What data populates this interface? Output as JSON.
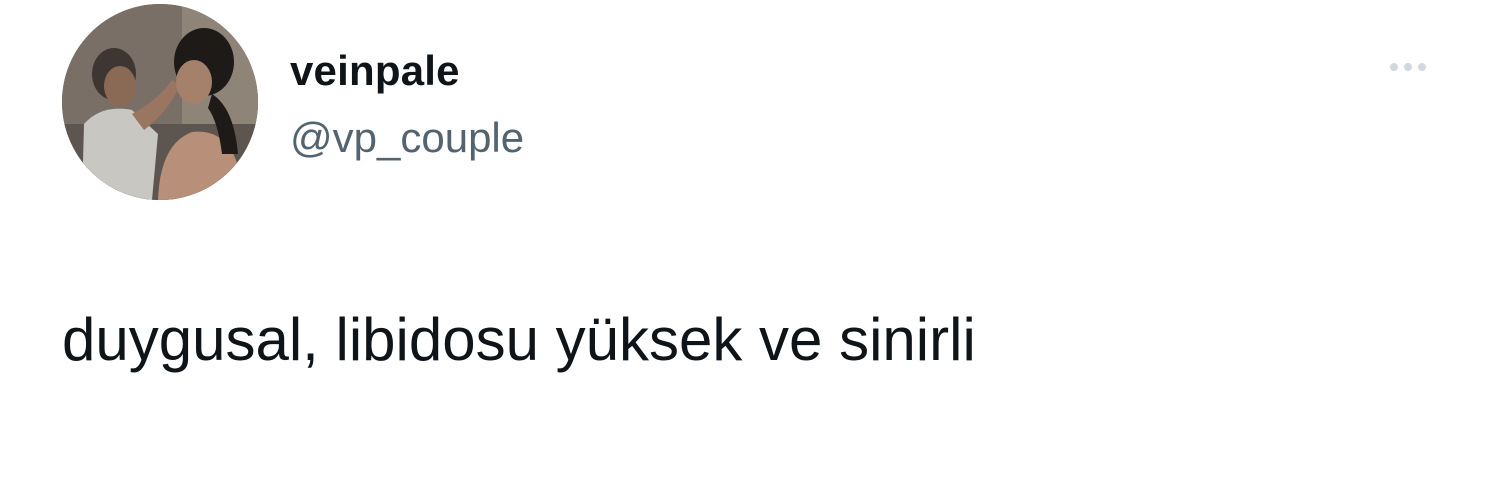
{
  "tweet": {
    "author": {
      "display_name": "veinpale",
      "handle": "@vp_couple",
      "avatar_icon": "avatar-photo"
    },
    "more_icon": "more-horizontal-icon",
    "text": "duygusal, libidosu yüksek ve sinirli"
  },
  "colors": {
    "background": "#ffffff",
    "primary_text": "#0f1419",
    "secondary_text": "#536471",
    "more_dots": "#cfd9de"
  }
}
